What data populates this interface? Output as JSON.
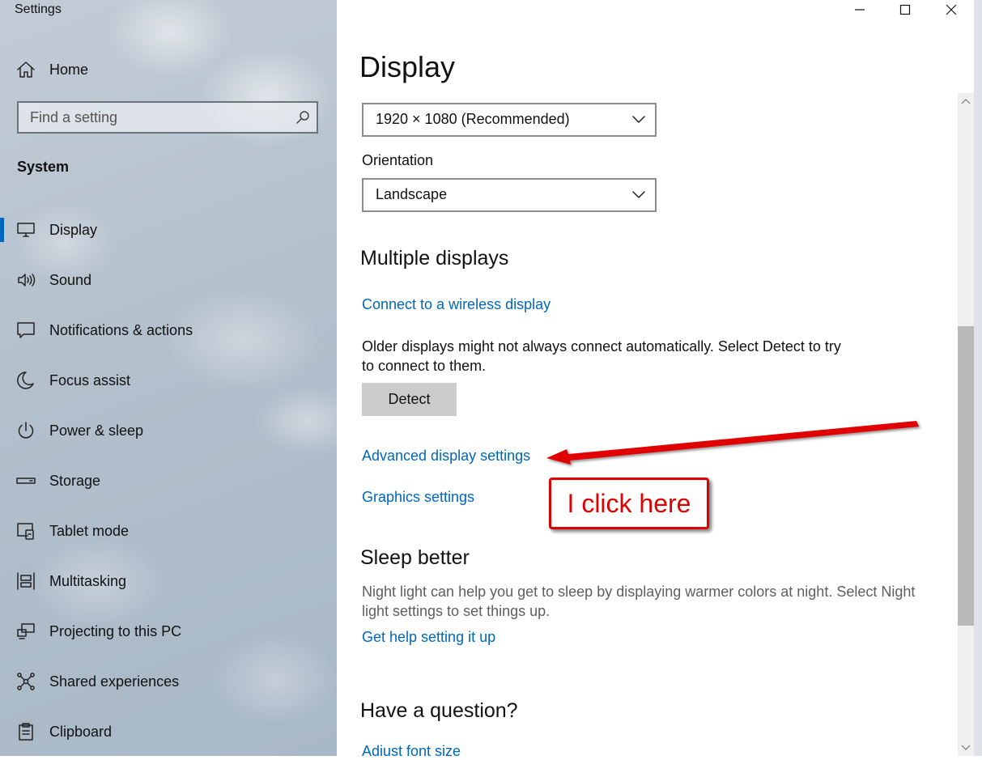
{
  "window": {
    "title": "Settings",
    "controls": [
      "minimize",
      "maximize",
      "close"
    ]
  },
  "sidebar": {
    "home_label": "Home",
    "search_placeholder": "Find a setting",
    "section_label": "System",
    "items": [
      {
        "label": "Display",
        "icon": "monitor-icon",
        "active": true
      },
      {
        "label": "Sound",
        "icon": "speaker-icon",
        "active": false
      },
      {
        "label": "Notifications & actions",
        "icon": "notification-icon",
        "active": false
      },
      {
        "label": "Focus assist",
        "icon": "moon-icon",
        "active": false
      },
      {
        "label": "Power & sleep",
        "icon": "power-icon",
        "active": false
      },
      {
        "label": "Storage",
        "icon": "storage-icon",
        "active": false
      },
      {
        "label": "Tablet mode",
        "icon": "tablet-mode-icon",
        "active": false
      },
      {
        "label": "Multitasking",
        "icon": "multitasking-icon",
        "active": false
      },
      {
        "label": "Projecting to this PC",
        "icon": "projecting-icon",
        "active": false
      },
      {
        "label": "Shared experiences",
        "icon": "shared-experiences-icon",
        "active": false
      },
      {
        "label": "Clipboard",
        "icon": "clipboard-icon",
        "active": false
      }
    ]
  },
  "main": {
    "title": "Display",
    "resolution_value": "1920 × 1080 (Recommended)",
    "orientation_label": "Orientation",
    "orientation_value": "Landscape",
    "multiple_displays": {
      "heading": "Multiple displays",
      "connect_link": "Connect to a wireless display",
      "description": "Older displays might not always connect automatically. Select Detect to try to connect to them.",
      "detect_button": "Detect"
    },
    "advanced_link": "Advanced display settings",
    "graphics_link": "Graphics settings",
    "sleep_better": {
      "heading": "Sleep better",
      "description": "Night light can help you get to sleep by displaying warmer colors at night. Select Night light settings to set things up.",
      "help_link": "Get help setting it up"
    },
    "have_a_question": {
      "heading": "Have a question?",
      "link": "Adjust font size"
    }
  },
  "annotation": {
    "callout_text": "I click here",
    "color": "#e00000"
  },
  "colors": {
    "link": "#0067b8",
    "accent": "#0067c0"
  }
}
